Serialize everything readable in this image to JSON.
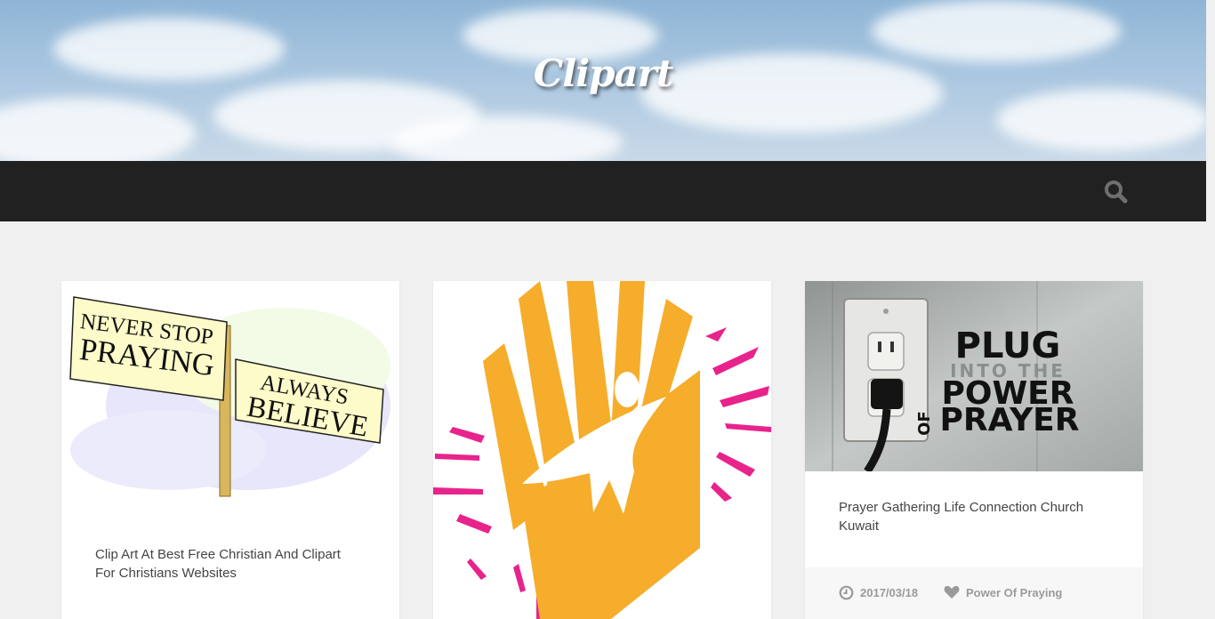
{
  "header": {
    "site_title": "Clipart",
    "search_icon": "search-icon"
  },
  "posts": [
    {
      "title": "Clip Art At Best Free Christian And Clipart For Christians Websites",
      "image": {
        "sign_top": "NEVER STOP PRAYING",
        "sign_bottom": "ALWAYS BELIEVE"
      }
    },
    {
      "title": "",
      "image": {
        "text": ""
      }
    },
    {
      "title": "Prayer Gathering Life Connection Church Kuwait",
      "image": {
        "line1": "PLUG",
        "line2": "INTO THE",
        "line3": "POWER",
        "line4": "OF",
        "line5": "PRAYER"
      },
      "date": "2017/03/18",
      "date_icon": "clock-icon",
      "category": "Power Of Praying",
      "category_icon": "heart-icon"
    }
  ],
  "colors": {
    "navbar": "#212121",
    "page_bg": "#f0f0f0",
    "accent_yellow": "#f5ad2b",
    "accent_pink": "#e8238c"
  }
}
